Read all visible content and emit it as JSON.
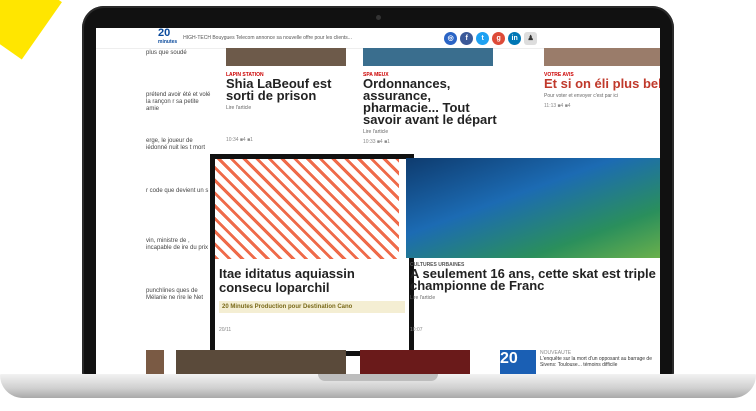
{
  "header": {
    "logo": "20",
    "logo_sub": "minutes",
    "ticker": "HIGH-TECH Bouygues Telecom annonce sa nouvelle offre pour les clients..."
  },
  "socials": [
    {
      "icon": "globe-icon",
      "color": "#2a64c5",
      "glyph": "◎"
    },
    {
      "icon": "facebook-icon",
      "color": "#3b5998",
      "glyph": "f"
    },
    {
      "icon": "twitter-icon",
      "color": "#1da1f2",
      "glyph": "t"
    },
    {
      "icon": "googleplus-icon",
      "color": "#dd4b39",
      "glyph": "g"
    },
    {
      "icon": "linkedin-icon",
      "color": "#0077b5",
      "glyph": "in"
    },
    {
      "icon": "user-icon",
      "color": "#dddddd",
      "glyph": "♟"
    }
  ],
  "left_column": [
    {
      "text": "plus que soudé"
    },
    {
      "text": "prétend avoir été et volé la rançon r sa petite amie"
    },
    {
      "text": "erge, le joueur de iédonné nuit les t mort"
    },
    {
      "text": "r code que devient un s"
    },
    {
      "text": "vin, ministre de , incapable de ire du prix"
    },
    {
      "text": "punchlines ques de Mélanie ne rire le Net"
    }
  ],
  "cards": [
    {
      "tag": "LAPIN STATION",
      "title": "Shia LaBeouf est sorti de prison",
      "link": "Lire l'article",
      "meta": "10:34  ■4  ■1"
    },
    {
      "tag": "SPA MEUX",
      "title": "Ordonnances, assurance, pharmacie... Tout savoir avant le départ",
      "link": "Lire l'article",
      "meta": "10:33  ■4  ■1"
    },
    {
      "tag": "VOTRE AVIS",
      "title": "Et si on éli plus belle de France",
      "link": "Pour voter et envoyer c'est par ici",
      "meta": "11:13  ■4  ■4"
    }
  ],
  "featured": {
    "title": "Itae iditatus aquiassin consecu loparchil",
    "sponsor": "20 Minutes Production pour Destination Cano",
    "meta": "20/11"
  },
  "skate_card": {
    "tag": "CULTURES URBAINES",
    "title": "A seulement 16 ans, cette skat est triple championne de Franc",
    "link": "Lire l'article",
    "meta": "10:07"
  },
  "bottom": {
    "news_tag": "NOUVEAUTÉ",
    "news_text": "L'enquête sur la mort d'un opposant au barrage de Sivens: Toulouse... témoins difficile"
  }
}
